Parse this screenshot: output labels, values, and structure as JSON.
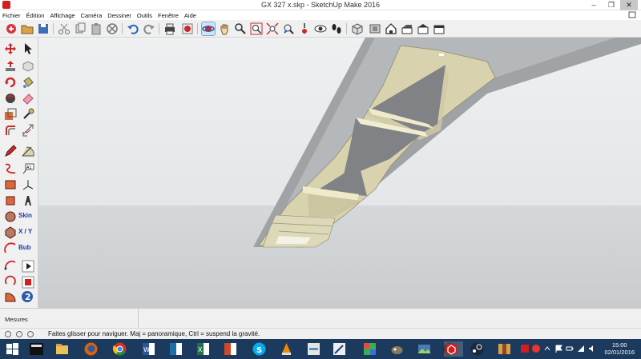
{
  "window": {
    "title": "GX 327 x.skp - SketchUp Make 2016",
    "controls": [
      "–",
      "❐",
      "✕"
    ]
  },
  "menu": {
    "items": [
      "Fichier",
      "Édition",
      "Affichage",
      "Caméra",
      "Dessiner",
      "Outils",
      "Fenêtre",
      "Aide"
    ]
  },
  "left_tools": {
    "skin_label": "Skin",
    "xy_label": "X / Y",
    "bub_label": "Bub"
  },
  "mesures": {
    "label": "Mesures"
  },
  "status": {
    "hint": "Faites glisser pour naviguer. Maj = panoramique, Ctrl =  suspend la gravité."
  },
  "taskbar": {
    "time": "15:00",
    "date": "02/01/2016"
  },
  "colors": {
    "sky": "#e3e6e8",
    "ground": "#c2c6c9",
    "model_face": "#d8d3ae",
    "model_shadow": "#7c7e80",
    "taskbar": "#1b3a5e"
  }
}
